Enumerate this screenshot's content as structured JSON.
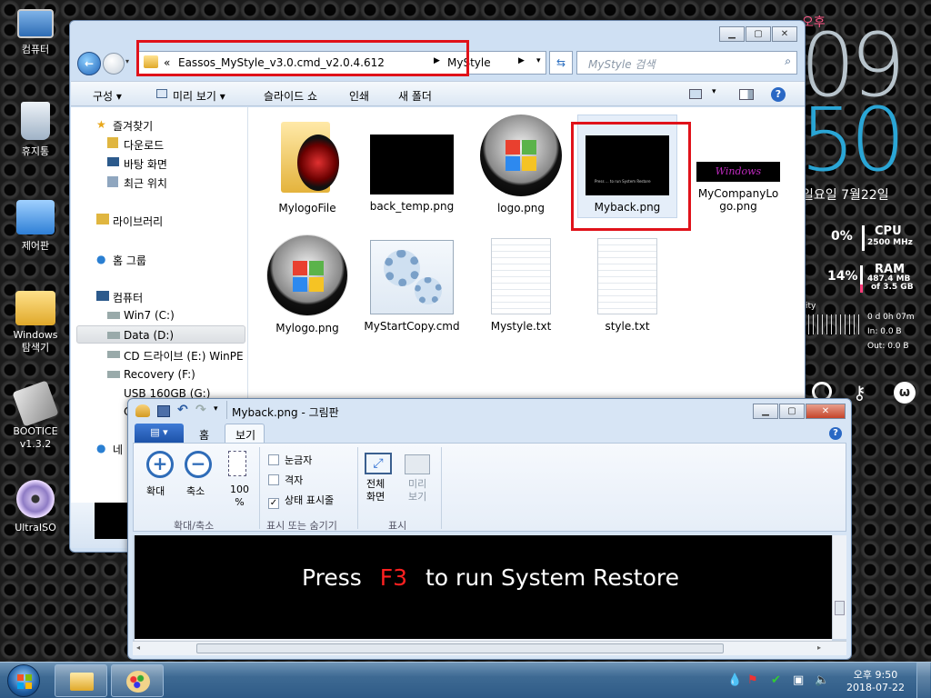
{
  "desktop": {
    "icons": [
      {
        "label": "컴퓨터",
        "icon": "computer-icon"
      },
      {
        "label": "휴지통",
        "icon": "recycle-bin-icon"
      },
      {
        "label": "제어판",
        "icon": "control-panel-icon"
      },
      {
        "label": "Windows\n탐색기",
        "icon": "explorer-icon"
      },
      {
        "label": "BOOTICE\nv1.3.2",
        "icon": "bootice-icon"
      },
      {
        "label": "UltraISO",
        "icon": "ultraiso-icon"
      }
    ]
  },
  "gadgets": {
    "ampm": "오후",
    "hour": "09",
    "minute": "50",
    "date": "일요일 7월22일",
    "cpu_pct": "0%",
    "cpu_label": "CPU",
    "cpu_freq": "2500 MHz",
    "ram_pct": "14%",
    "ram_label": "RAM",
    "ram_used": "487.4 MB",
    "ram_total": "of  3.5 GB",
    "net_label": "ity",
    "uptime": "0 d 0h 07m",
    "net_in": "In: 0.0 B",
    "net_out": "Out: 0.0 B"
  },
  "explorer": {
    "breadcrumb": [
      "«",
      "Eassos_MyStyle_v3.0.cmd_v2.0.4.612",
      "MyStyle"
    ],
    "search_placeholder": "MyStyle 검색",
    "toolbar": {
      "organize": "구성 ▾",
      "preview": "미리 보기 ▾",
      "slideshow": "슬라이드 쇼",
      "print": "인쇄",
      "new_folder": "새 폴더"
    },
    "nav": {
      "favorites": "즐겨찾기",
      "downloads": "다운로드",
      "desktop": "바탕 화면",
      "recent": "최근 위치",
      "libraries": "라이브러리",
      "homegroup": "홈 그룹",
      "computer": "컴퓨터",
      "drives": [
        "Win7 (C:)",
        "Data (D:)",
        "CD 드라이브 (E:) WinPE",
        "Recovery (F:)",
        "USB 160GB (G:)",
        "C"
      ],
      "network": "네"
    },
    "files": [
      {
        "name": "MylogoFile"
      },
      {
        "name": "back_temp.png"
      },
      {
        "name": "logo.png"
      },
      {
        "name": "Myback.png"
      },
      {
        "name": "MyCompanyLogo.png"
      },
      {
        "name": "Mylogo.png"
      },
      {
        "name": "MyStartCopy.cmd"
      },
      {
        "name": "Mystyle.txt"
      },
      {
        "name": "style.txt"
      }
    ],
    "company_logo_text": "Windows",
    "myback_thumb_text": "Press ... to run System Restore"
  },
  "paint": {
    "title": "Myback.png - 그림판",
    "tabs": [
      "홈",
      "보기"
    ],
    "zoom_in": "확대",
    "zoom_out": "축소",
    "zoom_100": "100\n%",
    "group_zoom": "확대/축소",
    "ruler": "눈금자",
    "grid": "격자",
    "statusbar": "상태 표시줄",
    "group_show": "표시 또는 숨기기",
    "fullscreen": "전체\n화면",
    "thumbnail": "미리\n보기",
    "group_display": "표시",
    "canvas_text_before": "Press",
    "canvas_key": "F3",
    "canvas_text_after": "to run System Restore",
    "statusbar_checked": true
  },
  "taskbar": {
    "time": "오후 9:50",
    "date": "2018-07-22"
  },
  "colors": {
    "highlight_red": "#e0121a",
    "canvas_key": "#ff2020",
    "window_frame": "#cfe0f3"
  }
}
